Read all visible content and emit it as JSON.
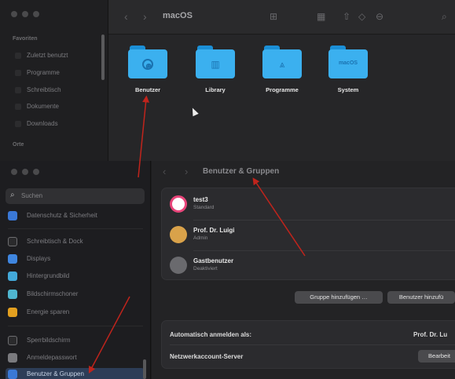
{
  "finder": {
    "sidebar_section_favorites": "Favoriten",
    "sidebar_items": [
      "Zuletzt benutzt",
      "Programme",
      "Schreibtisch",
      "Dokumente",
      "Downloads"
    ],
    "sidebar_section_places": "Orte",
    "path_title": "macOS",
    "folders": [
      {
        "label": "Benutzer",
        "icon": "user-folder-icon"
      },
      {
        "label": "Library",
        "icon": "library-folder-icon"
      },
      {
        "label": "Programme",
        "icon": "applications-folder-icon"
      },
      {
        "label": "System",
        "icon": "system-folder-icon",
        "badge": "macOS"
      }
    ]
  },
  "settings": {
    "search_placeholder": "Suchen",
    "sidebar_items": [
      {
        "label": "Datenschutz & Sicherheit",
        "color": "#3a78d6"
      },
      {
        "label": "Schreibtisch & Dock",
        "color": "#2a2a2c"
      },
      {
        "label": "Displays",
        "color": "#3f86e0"
      },
      {
        "label": "Hintergrundbild",
        "color": "#43a9d9"
      },
      {
        "label": "Bildschirmschoner",
        "color": "#4fb6cf"
      },
      {
        "label": "Energie sparen",
        "color": "#e3a020"
      },
      {
        "label": "Sperrbildschirm",
        "color": "#2a2a2c"
      },
      {
        "label": "Anmeldepasswort",
        "color": "#7a7a7e"
      },
      {
        "label": "Benutzer & Gruppen",
        "color": "#3a78d6",
        "selected": true
      }
    ],
    "title": "Benutzer & Gruppen",
    "users": [
      {
        "name": "test3",
        "role": "Standard",
        "avatar": "#e8457a"
      },
      {
        "name": "Prof. Dr. Luigi",
        "role": "Admin",
        "avatar": "#d9a24a"
      },
      {
        "name": "Gastbenutzer",
        "role": "Deaktiviert",
        "avatar": "#6a6a6e"
      }
    ],
    "add_group_button": "Gruppe hinzufügen …",
    "add_user_button": "Benutzer hinzufü",
    "auto_login_label": "Automatisch anmelden als:",
    "auto_login_value": "Prof. Dr. Lu",
    "network_server_label": "Netzwerkaccount-Server",
    "edit_button": "Bearbeit"
  },
  "colors": {
    "accent": "#3a78d6",
    "folder": "#3bb0ef",
    "annotation_arrow": "#c0241c"
  }
}
